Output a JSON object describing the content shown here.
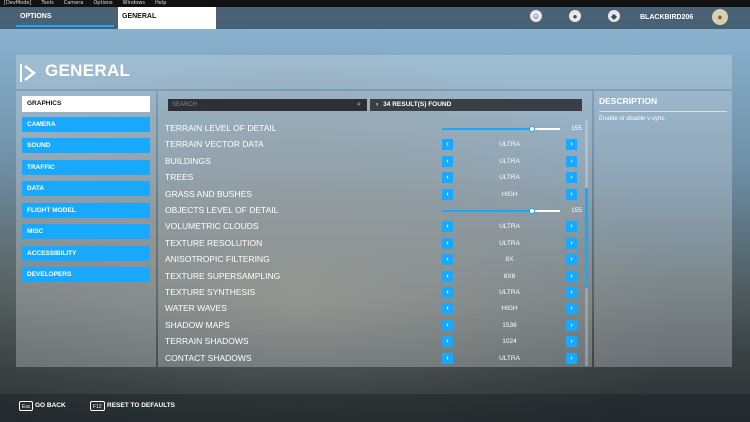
{
  "devmenu": [
    "[DevMode]",
    "Tools",
    "Camera",
    "Options",
    "Windows",
    "Help"
  ],
  "top": {
    "tab_options": "OPTIONS",
    "tab_general": "GENERAL",
    "username": "BLACKBIRD206"
  },
  "page_title": "GENERAL",
  "sidebar": {
    "items": [
      "GRAPHICS",
      "CAMERA",
      "SOUND",
      "TRAFFIC",
      "DATA",
      "FLIGHT MODEL",
      "MISC",
      "ACCESSIBILITY",
      "DEVELOPERS"
    ],
    "active": "GRAPHICS"
  },
  "search": {
    "placeholder": "SEARCH",
    "results": "34 RESULT(S) FOUND"
  },
  "settings": [
    {
      "label": "TERRAIN LEVEL OF DETAIL",
      "type": "slider",
      "value": "155",
      "fraction": 0.76
    },
    {
      "label": "TERRAIN VECTOR DATA",
      "type": "choice",
      "value": "ULTRA"
    },
    {
      "label": "BUILDINGS",
      "type": "choice",
      "value": "ULTRA"
    },
    {
      "label": "TREES",
      "type": "choice",
      "value": "ULTRA"
    },
    {
      "label": "GRASS AND BUSHES",
      "type": "choice",
      "value": "HIGH"
    },
    {
      "label": "OBJECTS LEVEL OF DETAIL",
      "type": "slider",
      "value": "155",
      "fraction": 0.76
    },
    {
      "label": "VOLUMETRIC CLOUDS",
      "type": "choice",
      "value": "ULTRA"
    },
    {
      "label": "TEXTURE RESOLUTION",
      "type": "choice",
      "value": "ULTRA"
    },
    {
      "label": "ANISOTROPIC FILTERING",
      "type": "choice",
      "value": "8X"
    },
    {
      "label": "TEXTURE SUPERSAMPLING",
      "type": "choice",
      "value": "8X8"
    },
    {
      "label": "TEXTURE SYNTHESIS",
      "type": "choice",
      "value": "ULTRA"
    },
    {
      "label": "WATER WAVES",
      "type": "choice",
      "value": "HIGH"
    },
    {
      "label": "SHADOW MAPS",
      "type": "choice",
      "value": "1536"
    },
    {
      "label": "TERRAIN SHADOWS",
      "type": "choice",
      "value": "1024"
    },
    {
      "label": "CONTACT SHADOWS",
      "type": "choice",
      "value": "ULTRA"
    }
  ],
  "description": {
    "title": "DESCRIPTION",
    "text": "Enable or disable v-sync."
  },
  "footer": {
    "back_key": "Esc",
    "back_label": "GO BACK",
    "reset_key": "F12",
    "reset_label": "RESET TO DEFAULTS"
  },
  "colors": {
    "accent": "#18a9ff",
    "active_bg": "#ffffff"
  },
  "icons": [
    "friends-icon",
    "profile-icon",
    "notifications-icon",
    "avatar-icon",
    "search-icon",
    "chevron-left-icon",
    "chevron-right-icon"
  ]
}
